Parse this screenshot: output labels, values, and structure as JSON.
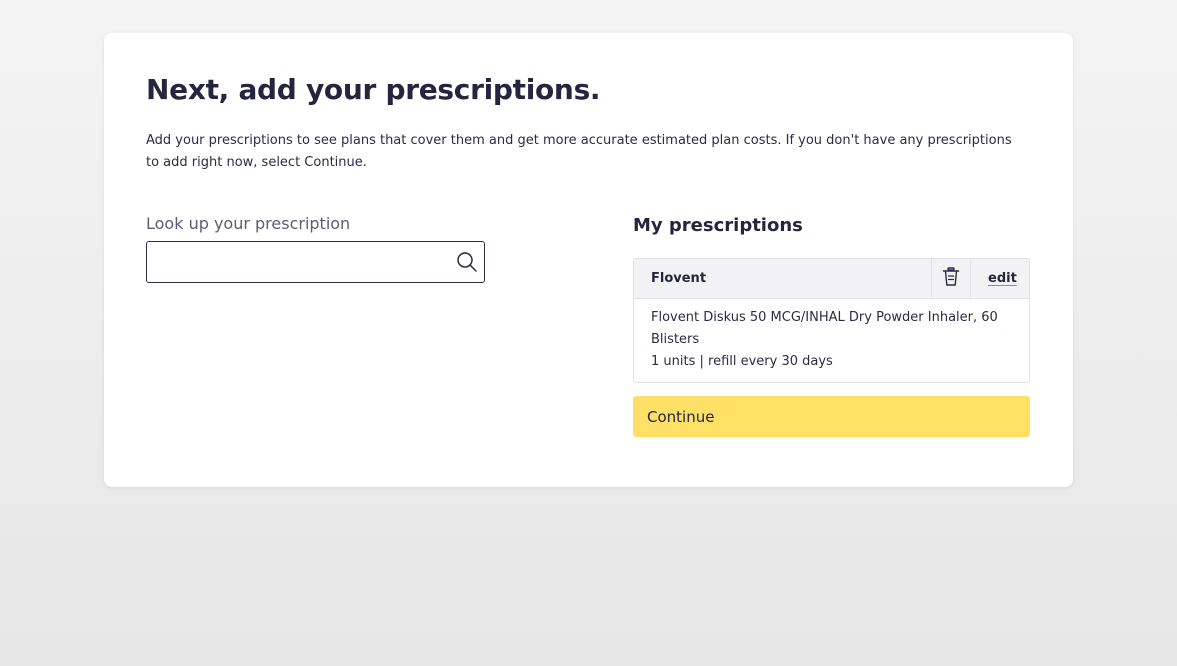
{
  "page": {
    "title": "Next, add your prescriptions.",
    "intro": "Add your prescriptions to see plans that cover them and get more accurate estimated plan costs. If you don't have any prescriptions to add right now, select Continue."
  },
  "lookup": {
    "label": "Look up your prescription",
    "value": "",
    "placeholder": "",
    "icon": "search-icon"
  },
  "my_prescriptions": {
    "heading": "My prescriptions",
    "items": [
      {
        "name": "Flovent",
        "description": "Flovent Diskus 50 MCG/INHAL Dry Powder Inhaler, 60 Blisters",
        "dosage": "1 units | refill every 30 days",
        "delete_icon": "trash-icon",
        "edit_label": "edit"
      }
    ]
  },
  "actions": {
    "continue_label": "Continue"
  },
  "colors": {
    "accent_button": "#ffe066",
    "link_underline": "#2eb8a6",
    "heading_text": "#25253f"
  }
}
